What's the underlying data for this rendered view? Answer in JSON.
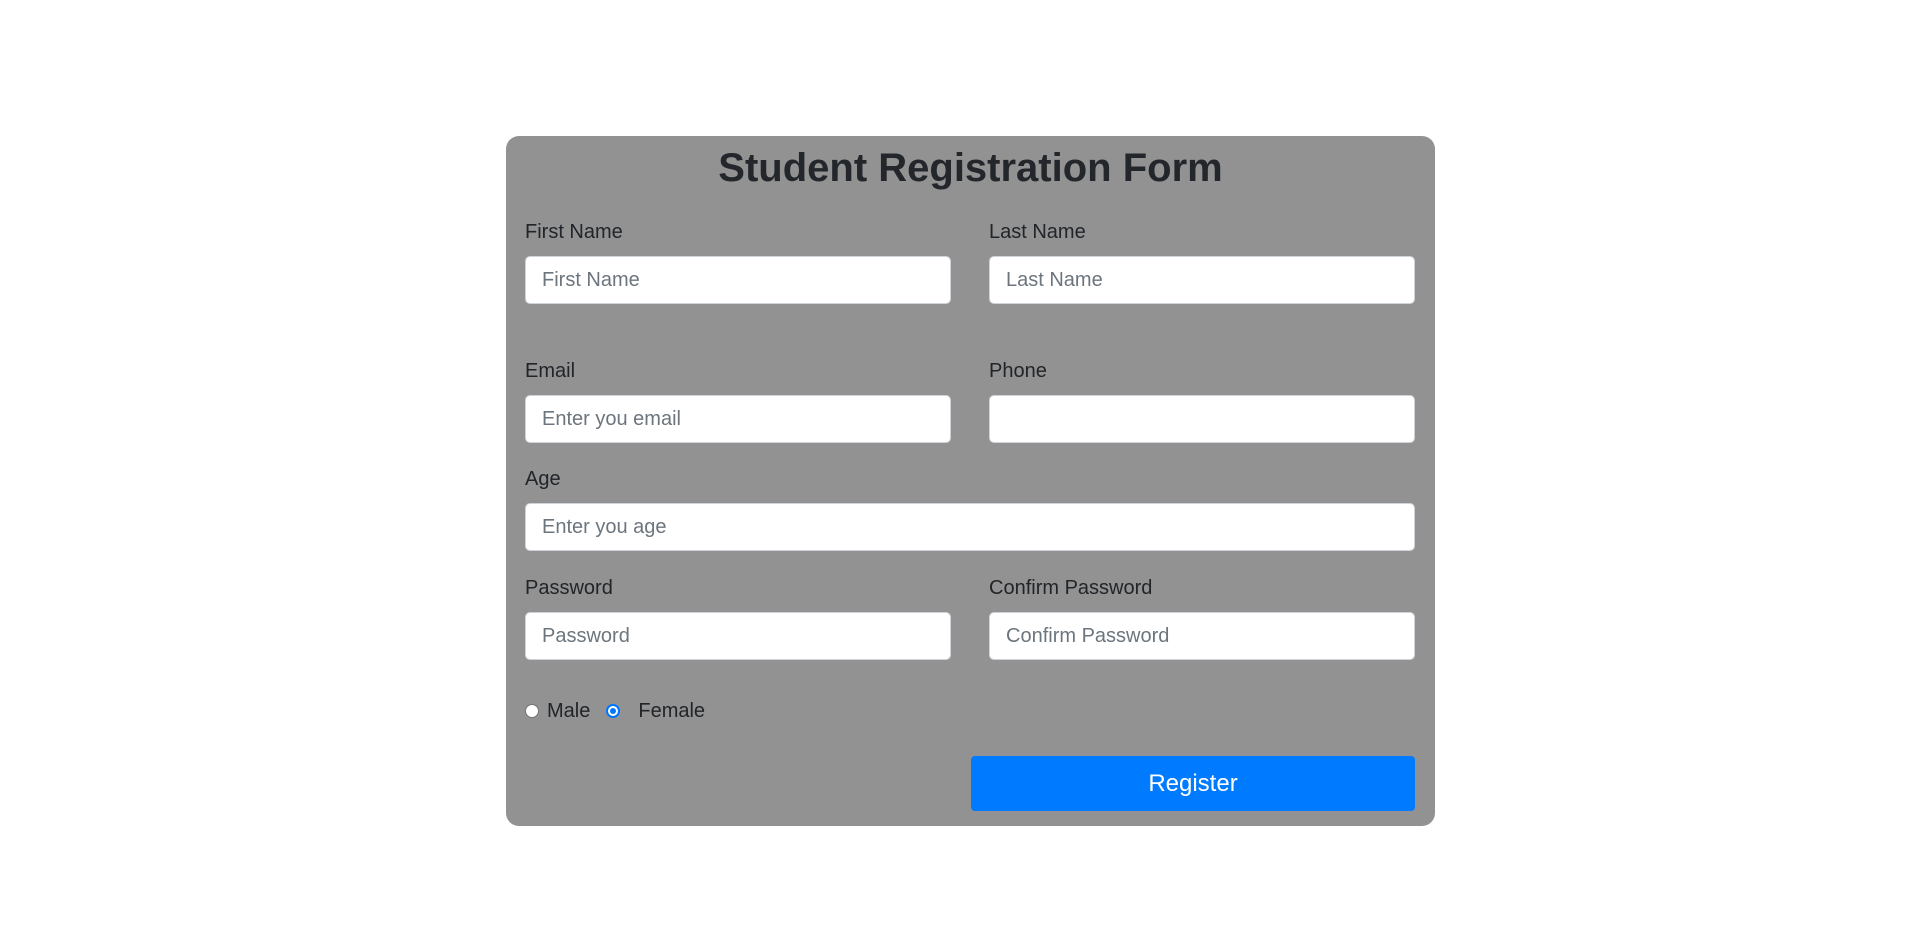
{
  "form": {
    "title": "Student Registration Form",
    "first_name": {
      "label": "First Name",
      "placeholder": "First Name",
      "value": ""
    },
    "last_name": {
      "label": "Last Name",
      "placeholder": "Last Name",
      "value": ""
    },
    "email": {
      "label": "Email",
      "placeholder": "Enter you email",
      "value": ""
    },
    "phone": {
      "label": "Phone",
      "placeholder": "",
      "value": ""
    },
    "age": {
      "label": "Age",
      "placeholder": "Enter you age",
      "value": ""
    },
    "password": {
      "label": "Password",
      "placeholder": "Password",
      "value": ""
    },
    "confirm_password": {
      "label": "Confirm Password",
      "placeholder": "Confirm Password",
      "value": ""
    },
    "gender": {
      "options": [
        "Male",
        "Female"
      ],
      "selected": "Female"
    },
    "register_label": "Register"
  },
  "colors": {
    "card_background": "#929292",
    "page_background": "#ffffff",
    "primary_button": "#007bff",
    "radio_checked": "#0075ff"
  }
}
